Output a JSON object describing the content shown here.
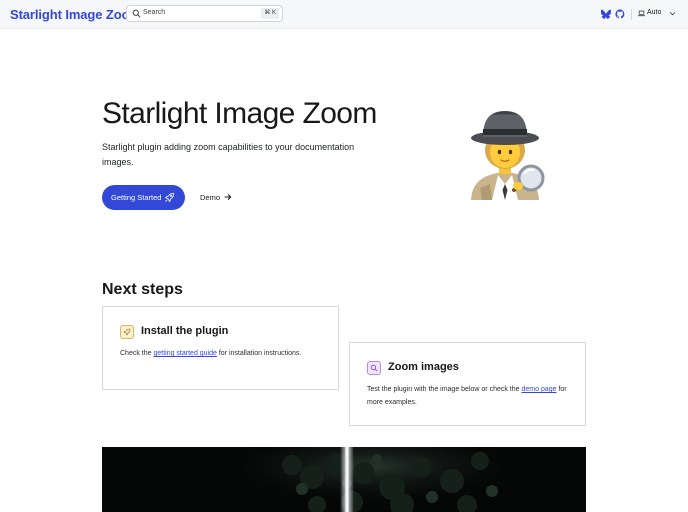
{
  "header": {
    "site_title": "Starlight Image Zoom",
    "search": {
      "label": "Search",
      "shortcut": "⌘ K"
    },
    "social_links": [
      {
        "name": "bluesky-icon"
      },
      {
        "name": "github-icon"
      }
    ],
    "theme_select": {
      "value": "Auto",
      "icon": "laptop-icon"
    }
  },
  "hero": {
    "title": "Starlight Image Zoom",
    "tagline": "Starlight plugin adding zoom capabilities to your documentation images.",
    "actions": {
      "primary_label": "Getting Started",
      "primary_icon": "rocket-icon",
      "secondary_label": "Demo",
      "secondary_icon": "arrow-right-icon"
    },
    "image": "detective-emoji"
  },
  "next_steps": {
    "title": "Next steps",
    "cards": [
      {
        "title": "Install the plugin",
        "icon": "rocket-icon",
        "body_before": "Check the ",
        "link": "getting started guide",
        "body_after": " for installation instructions."
      },
      {
        "title": "Zoom images",
        "icon": "magnifier-icon",
        "body_before": "Test the plugin with the image below or check the ",
        "link": "demo page",
        "body_after": " for more examples."
      }
    ]
  },
  "colors": {
    "accent": "#3348d6",
    "header_bg": "#f6f7f9",
    "text": "#17181c"
  }
}
